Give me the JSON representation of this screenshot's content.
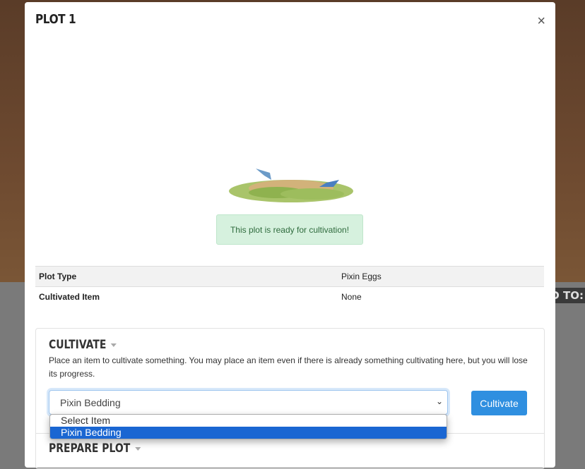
{
  "background": {
    "side_text": "ED TO:"
  },
  "modal": {
    "title": "PLOT 1",
    "close": "×"
  },
  "status": "This plot is ready for cultivation!",
  "details": [
    {
      "label": "Plot Type",
      "value": "Pixin Eggs"
    },
    {
      "label": "Cultivated Item",
      "value": "None"
    }
  ],
  "cultivate": {
    "heading": "CULTIVATE",
    "description": "Place an item to cultivate something. You may place an item even if there is already something cultivating here, but you will lose its progress.",
    "selected": "Pixin Bedding",
    "options": [
      "Select Item",
      "Pixin Bedding"
    ],
    "button": "Cultivate"
  },
  "prepare": {
    "heading": "PREPARE PLOT"
  },
  "colors": {
    "accent": "#2f8fe0",
    "highlight": "#1a66d2",
    "alert_bg": "#d6f1de"
  }
}
